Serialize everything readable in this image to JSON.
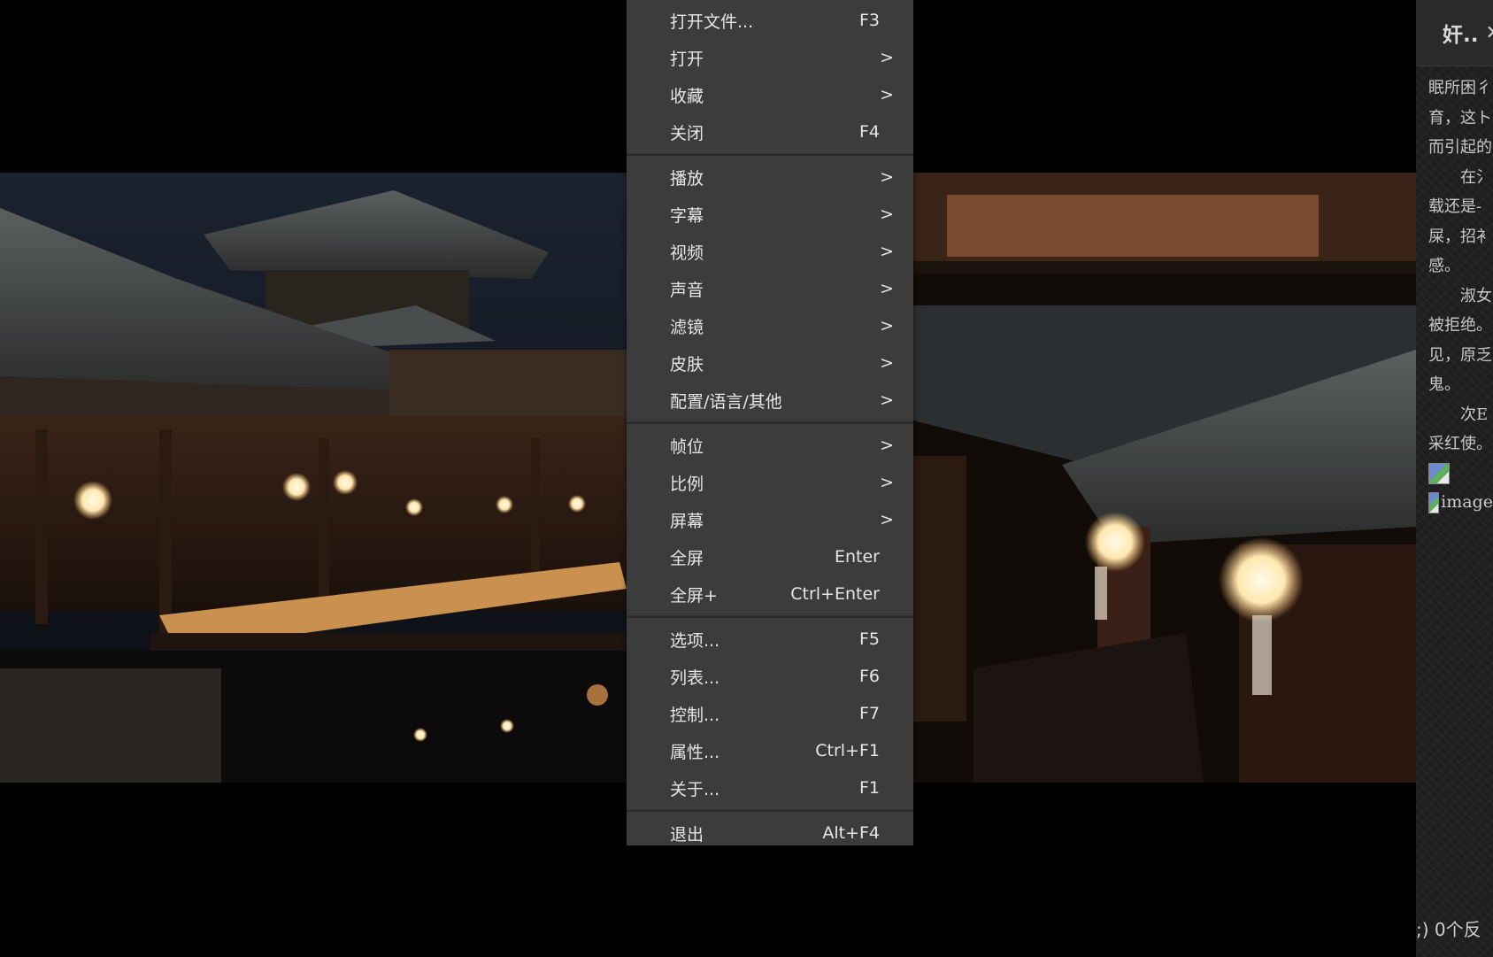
{
  "side_panel": {
    "title": "奸..",
    "close_icon": "✕",
    "lines": [
      "眠所困彳",
      "育，这ト",
      "而引起的",
      "　　在氵",
      "载还是-",
      "屎，招衤",
      "感。",
      "　　淑女",
      "被拒绝。",
      "见，原乏",
      "鬼。",
      "　　次E",
      "采红使。"
    ],
    "broken_images": [
      "",
      "image"
    ],
    "footer": ";) 0个反"
  },
  "menu": {
    "groups": [
      [
        {
          "label": "打开文件...",
          "shortcut": "F3"
        },
        {
          "label": "打开",
          "arrow": ">"
        },
        {
          "label": "收藏",
          "arrow": ">"
        },
        {
          "label": "关闭",
          "shortcut": "F4"
        }
      ],
      [
        {
          "label": "播放",
          "arrow": ">"
        },
        {
          "label": "字幕",
          "arrow": ">"
        },
        {
          "label": "视频",
          "arrow": ">"
        },
        {
          "label": "声音",
          "arrow": ">"
        },
        {
          "label": "滤镜",
          "arrow": ">"
        },
        {
          "label": "皮肤",
          "arrow": ">"
        },
        {
          "label": "配置/语言/其他",
          "arrow": ">"
        }
      ],
      [
        {
          "label": "帧位",
          "arrow": ">"
        },
        {
          "label": "比例",
          "arrow": ">"
        },
        {
          "label": "屏幕",
          "arrow": ">"
        },
        {
          "label": "全屏",
          "shortcut": "Enter"
        },
        {
          "label": "全屏+",
          "shortcut": "Ctrl+Enter"
        }
      ],
      [
        {
          "label": "选项...",
          "shortcut": "F5"
        },
        {
          "label": "列表...",
          "shortcut": "F6"
        },
        {
          "label": "控制...",
          "shortcut": "F7"
        },
        {
          "label": "属性...",
          "shortcut": "Ctrl+F1"
        },
        {
          "label": "关于...",
          "shortcut": "F1"
        }
      ],
      [
        {
          "label": "退出",
          "shortcut": "Alt+F4"
        }
      ]
    ]
  }
}
